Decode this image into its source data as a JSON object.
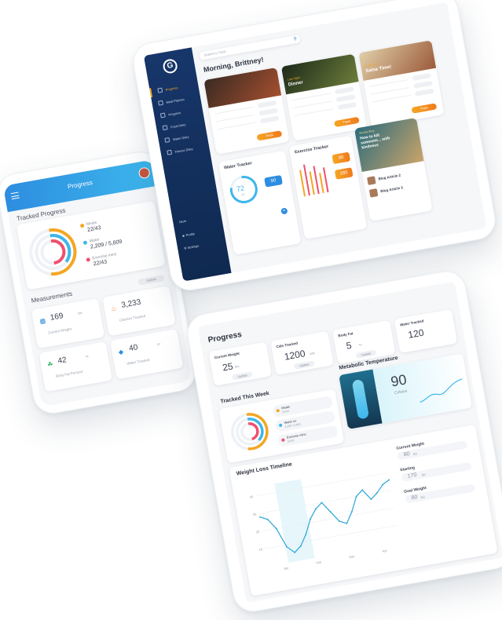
{
  "phone": {
    "header_title": "Progress",
    "section_title": "Tracked Progress",
    "legend": [
      {
        "label": "Meals",
        "value": "22/43",
        "color": "#f5a623"
      },
      {
        "label": "Water",
        "value": "2,209 / 5,809",
        "color": "#3db7ec"
      },
      {
        "label": "Exercise mins",
        "value": "22/43",
        "color": "#f0506e"
      }
    ],
    "measurements_title": "Measurements",
    "update_label": "Update",
    "tiles": [
      {
        "value": "169",
        "unit": "lbs",
        "label": "Current Weight",
        "icon": "calendar-icon"
      },
      {
        "value": "3,233",
        "unit": "",
        "label": "Calories Tracked",
        "icon": "flame-icon"
      },
      {
        "value": "42",
        "unit": "%",
        "label": "Body Fat Percent",
        "icon": "leaf-icon"
      },
      {
        "value": "40",
        "unit": "oz",
        "label": "Water Tracked",
        "icon": "droplet-icon"
      }
    ]
  },
  "tablet1": {
    "search_placeholder": "Search to Track",
    "greeting": "Morning, Brittney!",
    "nav": [
      "Progress",
      "Meal Planner",
      "Progress",
      "Food Diary",
      "Water Diary",
      "Fitness Diary"
    ],
    "nav_more": "More",
    "nav_profile": "Profile",
    "nav_settings": "Settings",
    "meal_cards": [
      {
        "tag": "",
        "name": "",
        "cta": "Track"
      },
      {
        "tag": "Late Night",
        "name": "Dinner",
        "cta": "Track"
      },
      {
        "tag": "Grab & Go",
        "name": "Salsa Time!",
        "cta": "Track"
      }
    ],
    "water_title": "Water Tracker",
    "water_value": "72",
    "water_unit": "oz",
    "water_goal": "90",
    "exercise_title": "Exercise Tracker",
    "exercise_stat1": "90",
    "exercise_stat2": "180",
    "blog_kicker": "Weekly Blog",
    "blog_title": "How to kill someone... with kindness",
    "blog_items": [
      "Blog Article 2",
      "Blog Article 3"
    ]
  },
  "tablet2": {
    "title": "Progress",
    "cards": [
      {
        "label": "Current Weight",
        "value": "25",
        "unit": "lbs",
        "action": "Update"
      },
      {
        "label": "Cals Tracked",
        "value": "1200",
        "unit": "cals",
        "action": "Update"
      },
      {
        "label": "Body Fat",
        "value": "5",
        "unit": "%",
        "action": "Update"
      },
      {
        "label": "Water Tracked",
        "value": "120",
        "unit": "",
        "action": ""
      }
    ],
    "metabolic_title": "Metabolic Temperature",
    "metabolic_value": "90",
    "metabolic_unit": "Celsius",
    "week_title": "Tracked This Week",
    "week_legend": [
      {
        "label": "Meals",
        "value": "22/43",
        "color": "#f5a623"
      },
      {
        "label": "Water oz",
        "value": "2,209 / 5,809",
        "color": "#3db7ec"
      },
      {
        "label": "Exercise mins",
        "value": "22/43",
        "color": "#f0506e"
      }
    ],
    "timeline_title": "Weight Loss Timeline",
    "side_stats": [
      {
        "label": "Current Weight",
        "value": "80",
        "unit": "lbs"
      },
      {
        "label": "Starting",
        "value": "170",
        "unit": "lbs"
      },
      {
        "label": "Goal Weight",
        "value": "80",
        "unit": "lbs"
      }
    ],
    "y_ticks": [
      "40",
      "30",
      "20",
      "10"
    ],
    "x_ticks": [
      "Jan",
      "Feb",
      "Mar",
      "Apr"
    ]
  },
  "chart_data": {
    "type": "line",
    "ylim": [
      0,
      45
    ],
    "x": [
      0,
      1,
      2,
      3,
      4,
      5,
      6,
      7,
      8,
      9,
      10,
      11,
      12,
      13,
      14,
      15,
      16,
      17,
      18,
      19
    ],
    "series": [
      {
        "values": [
          28,
          26,
          20,
          9,
          5,
          8,
          14,
          22,
          27,
          30,
          24,
          18,
          16,
          22,
          30,
          33,
          27,
          30,
          34,
          36
        ]
      }
    ]
  }
}
